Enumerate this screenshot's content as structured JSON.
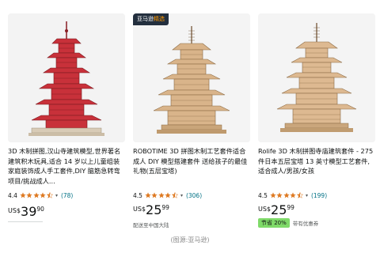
{
  "products": [
    {
      "badge": null,
      "title": "3D 木制拼图,汉山寺建筑模型,世界著名建筑积木玩具,适合 14 岁以上儿童组装家庭装饰成人手工套件,DIY 脑筋急转弯项目/挑战成人...",
      "rating": "4.4",
      "rating_value": 4.4,
      "reviews": "(78)",
      "currency": "US$",
      "price_whole": "39",
      "price_fraction": "90",
      "delivery": null,
      "deal_tag": null,
      "deal_text": null
    },
    {
      "badge": {
        "prefix": "亚马逊",
        "accent": "精选"
      },
      "title": "ROBOTIME 3D 拼图木制工艺套件适合成人 DIY 模型搭建套件 送给孩子的最佳礼物(五层宝塔)",
      "rating": "4.5",
      "rating_value": 4.5,
      "reviews": "(306)",
      "currency": "US$",
      "price_whole": "25",
      "price_fraction": "99",
      "delivery": "配送至中国大陆",
      "deal_tag": null,
      "deal_text": null
    },
    {
      "badge": null,
      "title": "Rolife 3D 木制拼图寺庙建筑套件 - 275 件日本五层宝塔 13 英寸模型工艺套件,适合成人/男孩/女孩",
      "rating": "4.5",
      "rating_value": 4.5,
      "reviews": "(199)",
      "currency": "US$",
      "price_whole": "25",
      "price_fraction": "99",
      "delivery": null,
      "deal_tag": "节省 20%",
      "deal_text": "带有优惠券"
    }
  ],
  "caption": "(图源:亚马逊)",
  "colors": {
    "star": "#de7921",
    "link": "#007185",
    "deal": "#7fda69",
    "badge_bg": "#232f3e",
    "badge_accent": "#ff9900",
    "pagoda_red": "#c8313a",
    "wood": "#d9b48a"
  }
}
